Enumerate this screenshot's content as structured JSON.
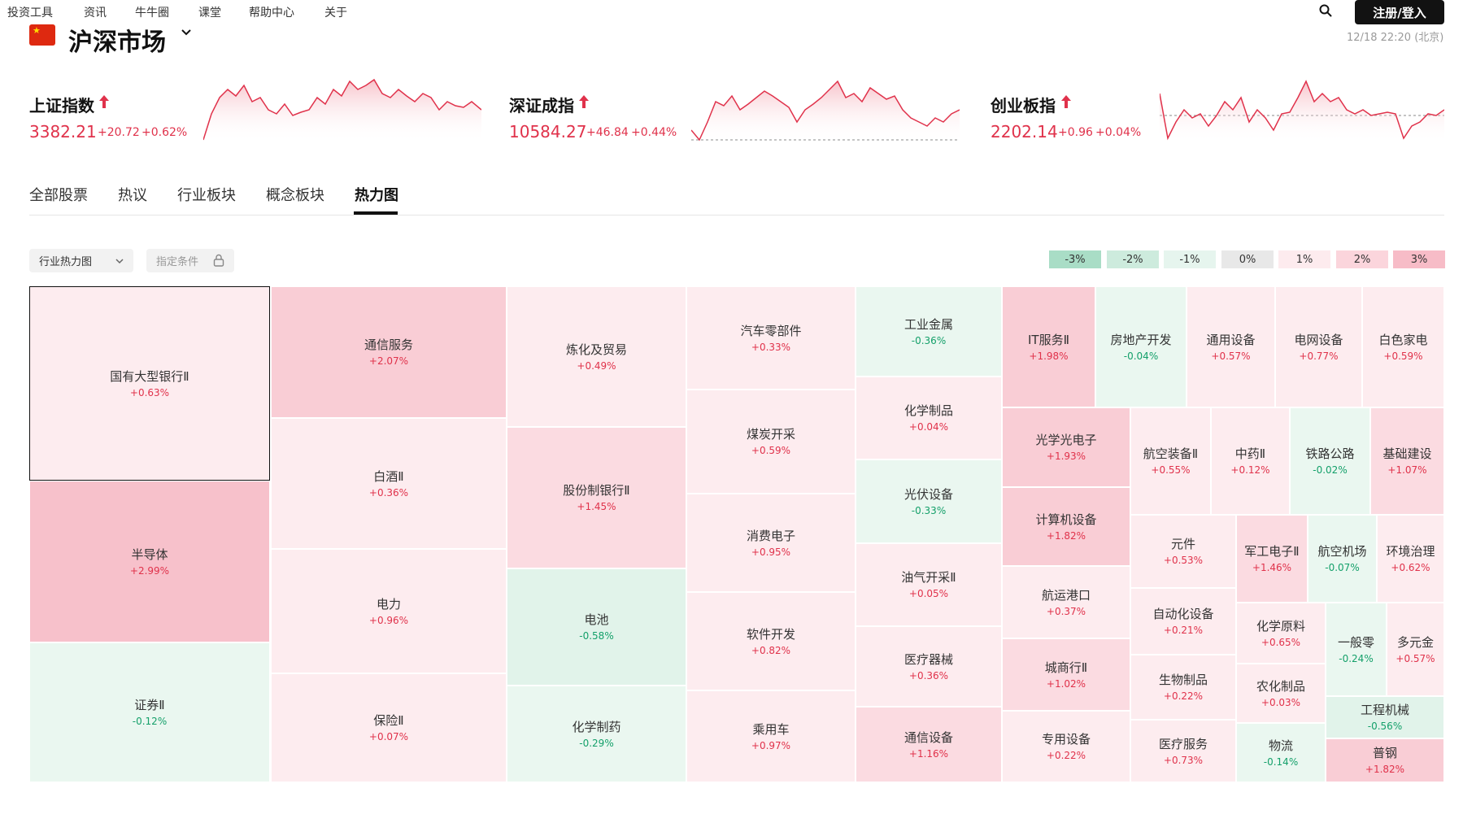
{
  "nav": {
    "items": [
      "投资工具",
      "资讯",
      "牛牛圈",
      "课堂",
      "帮助中心",
      "关于"
    ],
    "login_label": "注册/登入"
  },
  "market": {
    "title": "沪深市场",
    "timestamp": "12/18 22:20 (北京)"
  },
  "indices": [
    {
      "name": "上证指数",
      "value": "3382.21",
      "change": "+20.72",
      "pct": "+0.62%"
    },
    {
      "name": "深证成指",
      "value": "10584.27",
      "change": "+46.84",
      "pct": "+0.44%"
    },
    {
      "name": "创业板指",
      "value": "2202.14",
      "change": "+0.96",
      "pct": "+0.04%"
    }
  ],
  "tabs": [
    "全部股票",
    "热议",
    "行业板块",
    "概念板块",
    "热力图"
  ],
  "active_tab": "热力图",
  "filters": {
    "type_label": "行业热力图",
    "condition_label": "指定条件"
  },
  "legend": [
    "-3%",
    "-2%",
    "-1%",
    "0%",
    "1%",
    "2%",
    "3%"
  ],
  "heatmap": [
    {
      "name": "国有大型银行Ⅱ",
      "pct": "+0.63%"
    },
    {
      "name": "半导体",
      "pct": "+2.99%"
    },
    {
      "name": "证券Ⅱ",
      "pct": "-0.12%"
    },
    {
      "name": "通信服务",
      "pct": "+2.07%"
    },
    {
      "name": "白酒Ⅱ",
      "pct": "+0.36%"
    },
    {
      "name": "电力",
      "pct": "+0.96%"
    },
    {
      "name": "保险Ⅱ",
      "pct": "+0.07%"
    },
    {
      "name": "炼化及贸易",
      "pct": "+0.49%"
    },
    {
      "name": "股份制银行Ⅱ",
      "pct": "+1.45%"
    },
    {
      "name": "电池",
      "pct": "-0.58%"
    },
    {
      "name": "化学制药",
      "pct": "-0.29%"
    },
    {
      "name": "汽车零部件",
      "pct": "+0.33%"
    },
    {
      "name": "煤炭开采",
      "pct": "+0.59%"
    },
    {
      "name": "消费电子",
      "pct": "+0.95%"
    },
    {
      "name": "软件开发",
      "pct": "+0.82%"
    },
    {
      "name": "乘用车",
      "pct": "+0.97%"
    },
    {
      "name": "工业金属",
      "pct": "-0.36%"
    },
    {
      "name": "化学制品",
      "pct": "+0.04%"
    },
    {
      "name": "光伏设备",
      "pct": "-0.33%"
    },
    {
      "name": "油气开采Ⅱ",
      "pct": "+0.05%"
    },
    {
      "name": "医疗器械",
      "pct": "+0.36%"
    },
    {
      "name": "通信设备",
      "pct": "+1.16%"
    },
    {
      "name": "IT服务Ⅱ",
      "pct": "+1.98%"
    },
    {
      "name": "房地产开发",
      "pct": "-0.04%"
    },
    {
      "name": "通用设备",
      "pct": "+0.57%"
    },
    {
      "name": "电网设备",
      "pct": "+0.77%"
    },
    {
      "name": "白色家电",
      "pct": "+0.59%"
    },
    {
      "name": "光学光电子",
      "pct": "+1.93%"
    },
    {
      "name": "航空装备Ⅱ",
      "pct": "+0.55%"
    },
    {
      "name": "中药Ⅱ",
      "pct": "+0.12%"
    },
    {
      "name": "铁路公路",
      "pct": "-0.02%"
    },
    {
      "name": "基础建设",
      "pct": "+1.07%"
    },
    {
      "name": "计算机设备",
      "pct": "+1.82%"
    },
    {
      "name": "元件",
      "pct": "+0.53%"
    },
    {
      "name": "军工电子Ⅱ",
      "pct": "+1.46%"
    },
    {
      "name": "航空机场",
      "pct": "-0.07%"
    },
    {
      "name": "环境治理",
      "pct": "+0.62%"
    },
    {
      "name": "航运港口",
      "pct": "+0.37%"
    },
    {
      "name": "自动化设备",
      "pct": "+0.21%"
    },
    {
      "name": "化学原料",
      "pct": "+0.65%"
    },
    {
      "name": "一般零",
      "pct": "-0.24%"
    },
    {
      "name": "多元金",
      "pct": "+0.57%"
    },
    {
      "name": "城商行Ⅱ",
      "pct": "+1.02%"
    },
    {
      "name": "生物制品",
      "pct": "+0.22%"
    },
    {
      "name": "农化制品",
      "pct": "+0.03%"
    },
    {
      "name": "工程机械",
      "pct": "-0.56%"
    },
    {
      "name": "专用设备",
      "pct": "+0.22%"
    },
    {
      "name": "医疗服务",
      "pct": "+0.73%"
    },
    {
      "name": "物流",
      "pct": "-0.14%"
    },
    {
      "name": "普钢",
      "pct": "+1.82%"
    }
  ]
}
